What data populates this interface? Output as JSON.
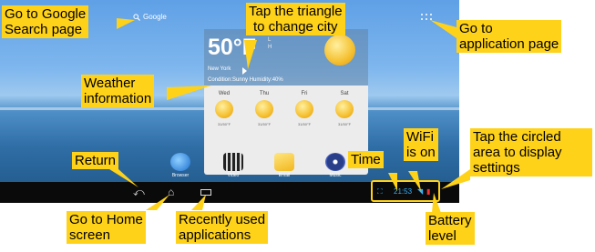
{
  "screen": {
    "search_label": "Google",
    "weather": {
      "temperature": "50°F",
      "hi_lo": "L\nH",
      "city": "New York",
      "condition": "Condition:Sunny Humidity:40%",
      "days": [
        {
          "name": "Wed",
          "range": "31/50°F"
        },
        {
          "name": "Thu",
          "range": "31/50°F"
        },
        {
          "name": "Fri",
          "range": "31/50°F"
        },
        {
          "name": "Sat",
          "range": "31/50°F"
        }
      ]
    },
    "dock": [
      {
        "label": "Browser",
        "icon": "globe-icon"
      },
      {
        "label": "Video",
        "icon": "clapper-icon"
      },
      {
        "label": "Email",
        "icon": "envelope-icon"
      },
      {
        "label": "Music",
        "icon": "music-disc-icon"
      }
    ],
    "status": {
      "time": "21:53"
    }
  },
  "annotations": {
    "google": "Go to Google\nSearch page",
    "triangle": "Tap the triangle\nto change city",
    "app_page": "Go to\napplication page",
    "weather": "Weather\ninformation",
    "return": "Return",
    "home": "Go to Home\nscreen",
    "recent": "Recently used\napplications",
    "time": "Time",
    "wifi": "WiFi\nis on",
    "settings": "Tap the circled\narea to display\nsettings",
    "battery": "Battery\nlevel"
  },
  "colors": {
    "callout": "#ffd21a",
    "clock": "#35b5ff"
  }
}
